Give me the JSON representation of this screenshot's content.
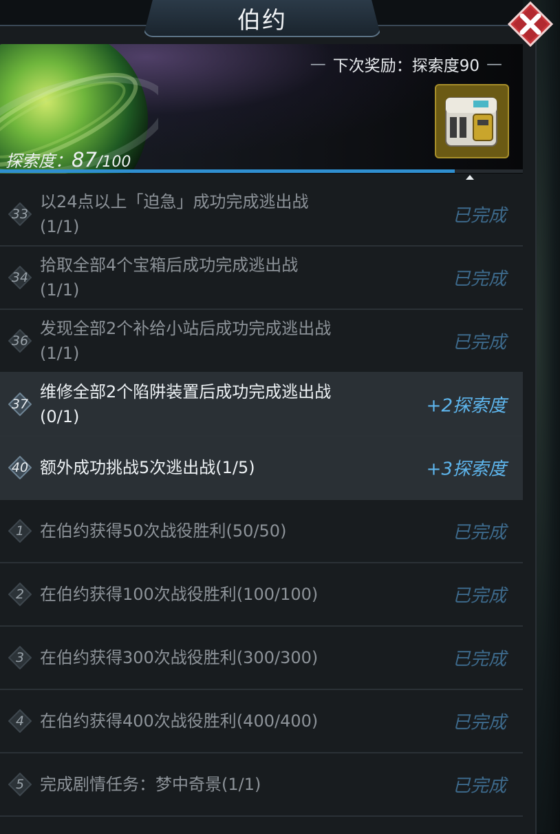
{
  "window": {
    "title": "伯约"
  },
  "banner": {
    "next_reward_label": "下次奖励：探索度90",
    "explore_label": "探索度：",
    "explore_current": "87",
    "explore_max": "/100",
    "explore_progress_fraction": 0.87
  },
  "tasks": [
    {
      "num": "33",
      "text": "以24点以上「迫急」成功完成逃出战",
      "progress": "(1/1)",
      "status": "已完成",
      "active": false
    },
    {
      "num": "34",
      "text": "拾取全部4个宝箱后成功完成逃出战",
      "progress": "(1/1)",
      "status": "已完成",
      "active": false
    },
    {
      "num": "36",
      "text": "发现全部2个补给小站后成功完成逃出战",
      "progress": "(1/1)",
      "status": "已完成",
      "active": false
    },
    {
      "num": "37",
      "text": "维修全部2个陷阱装置后成功完成逃出战",
      "progress": "(0/1)",
      "status": "+2探索度",
      "active": true
    },
    {
      "num": "40",
      "text": "额外成功挑战5次逃出战",
      "progress": "(1/5)",
      "status": "+3探索度",
      "active": true
    },
    {
      "num": "1",
      "text": "在伯约获得50次战役胜利",
      "progress": "(50/50)",
      "status": "已完成",
      "active": false
    },
    {
      "num": "2",
      "text": "在伯约获得100次战役胜利",
      "progress": "(100/100)",
      "status": "已完成",
      "active": false
    },
    {
      "num": "3",
      "text": "在伯约获得300次战役胜利",
      "progress": "(300/300)",
      "status": "已完成",
      "active": false
    },
    {
      "num": "4",
      "text": "在伯约获得400次战役胜利",
      "progress": "(400/400)",
      "status": "已完成",
      "active": false
    },
    {
      "num": "5",
      "text": "完成剧情任务：梦中奇景",
      "progress": "(1/1)",
      "status": "已完成",
      "active": false
    }
  ],
  "icons": {
    "close": "close-icon",
    "reward": "supply-crate-icon",
    "badge": "diamond-badge-icon",
    "planet": "planet-image"
  },
  "colors": {
    "accent_blue": "#2f8fd0",
    "status_done": "#3d6a8c",
    "status_reward": "#5eb6ee",
    "close_red": "#c8363a"
  }
}
